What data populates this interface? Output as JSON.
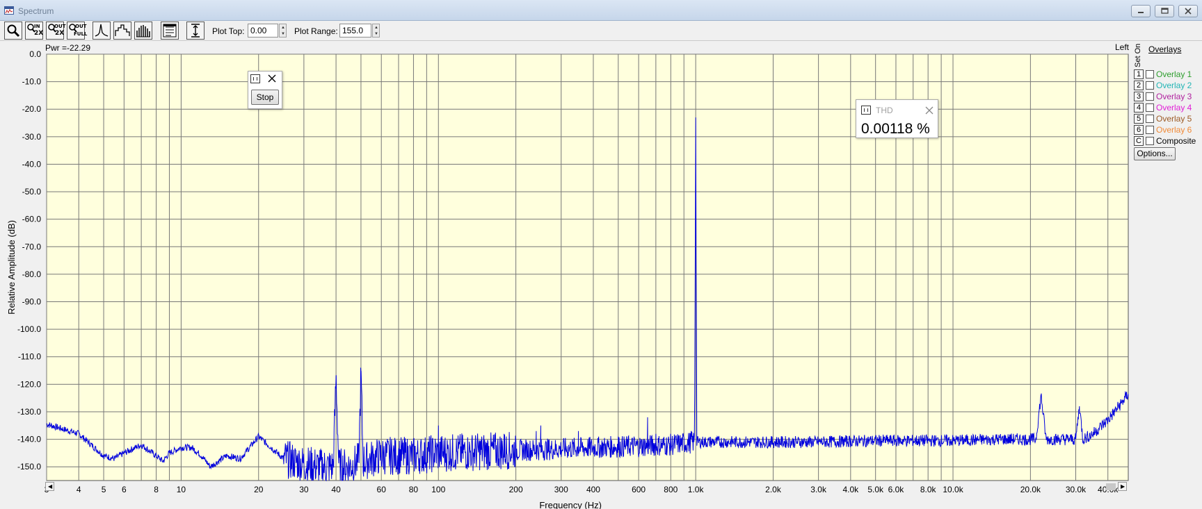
{
  "window": {
    "title": "Spectrum",
    "controls": [
      "minimize",
      "restore",
      "close"
    ]
  },
  "toolbar": {
    "buttons": [
      {
        "name": "zoom-icon"
      },
      {
        "name": "zoom-in-2x-icon",
        "line1": "IN",
        "line2": "2X"
      },
      {
        "name": "zoom-out-2x-icon",
        "line1": "OUT",
        "line2": "2X"
      },
      {
        "name": "zoom-out-full-icon",
        "line1": "OUT",
        "line2": "FULL"
      },
      {
        "name": "line-graph-icon"
      },
      {
        "name": "step-graph-icon"
      },
      {
        "name": "bar-graph-icon"
      },
      {
        "name": "settings-panel-icon"
      },
      {
        "name": "vertical-range-icon"
      }
    ],
    "plot_top_label": "Plot Top:",
    "plot_top_value": "0.00",
    "plot_range_label": "Plot Range:",
    "plot_range_value": "155.0"
  },
  "readout": {
    "power": "Pwr =-22.29",
    "channel": "Left"
  },
  "stop_window": {
    "button_label": "Stop"
  },
  "thd_window": {
    "title": "THD",
    "value": "0.00118 %"
  },
  "overlays": {
    "header": "Overlays",
    "column_labels": "Set On",
    "rows": [
      {
        "set": "1",
        "label": "Overlay 1",
        "color": "#2e9e2e",
        "checked": false
      },
      {
        "set": "2",
        "label": "Overlay 2",
        "color": "#22b5b5",
        "checked": false
      },
      {
        "set": "3",
        "label": "Overlay 3",
        "color": "#b0219e",
        "checked": false
      },
      {
        "set": "4",
        "label": "Overlay 4",
        "color": "#e01fd6",
        "checked": false
      },
      {
        "set": "5",
        "label": "Overlay 5",
        "color": "#9c5a24",
        "checked": false
      },
      {
        "set": "6",
        "label": "Overlay 6",
        "color": "#f08a38",
        "checked": false
      },
      {
        "set": "C",
        "label": "Composite",
        "color": "#000000",
        "checked": false
      }
    ],
    "options_label": "Options..."
  },
  "chart_data": {
    "type": "line",
    "title": "",
    "xlabel": "Frequency (Hz)",
    "ylabel": "Relative Amplitude (dB)",
    "x_scale": "log",
    "xlim": [
      3,
      48000
    ],
    "ylim": [
      -155,
      0
    ],
    "y_ticks": [
      "0.0",
      "-10.0",
      "-20.0",
      "-30.0",
      "-40.0",
      "-50.0",
      "-60.0",
      "-70.0",
      "-80.0",
      "-90.0",
      "-100.0",
      "-110.0",
      "-120.0",
      "-130.0",
      "-140.0",
      "-150.0"
    ],
    "x_tick_labels": [
      {
        "f": 3,
        "label": "3"
      },
      {
        "f": 4,
        "label": "4"
      },
      {
        "f": 5,
        "label": "5"
      },
      {
        "f": 6,
        "label": "6"
      },
      {
        "f": 8,
        "label": "8"
      },
      {
        "f": 10,
        "label": "10"
      },
      {
        "f": 20,
        "label": "20"
      },
      {
        "f": 30,
        "label": "30"
      },
      {
        "f": 40,
        "label": "40"
      },
      {
        "f": 60,
        "label": "60"
      },
      {
        "f": 80,
        "label": "80"
      },
      {
        "f": 100,
        "label": "100"
      },
      {
        "f": 200,
        "label": "200"
      },
      {
        "f": 300,
        "label": "300"
      },
      {
        "f": 400,
        "label": "400"
      },
      {
        "f": 600,
        "label": "600"
      },
      {
        "f": 800,
        "label": "800"
      },
      {
        "f": 1000,
        "label": "1.0k"
      },
      {
        "f": 2000,
        "label": "2.0k"
      },
      {
        "f": 3000,
        "label": "3.0k"
      },
      {
        "f": 4000,
        "label": "4.0k"
      },
      {
        "f": 5000,
        "label": "5.0k"
      },
      {
        "f": 6000,
        "label": "6.0k"
      },
      {
        "f": 8000,
        "label": "8.0k"
      },
      {
        "f": 10000,
        "label": "10.0k"
      },
      {
        "f": 20000,
        "label": "20.0k"
      },
      {
        "f": 30000,
        "label": "30.0k"
      },
      {
        "f": 40000,
        "label": "40.0k"
      }
    ],
    "grid": true,
    "background": "#ffffdd",
    "line_color": "#0000dd",
    "series": [
      {
        "name": "",
        "noise_floor_points": [
          [
            3,
            -134.5
          ],
          [
            4,
            -138
          ],
          [
            5,
            -146
          ],
          [
            5.5,
            -147
          ],
          [
            6,
            -145
          ],
          [
            7,
            -142
          ],
          [
            8,
            -146
          ],
          [
            8.5,
            -148
          ],
          [
            9,
            -145
          ],
          [
            10,
            -143
          ],
          [
            11,
            -143
          ],
          [
            12,
            -146
          ],
          [
            13,
            -150
          ],
          [
            15,
            -146
          ],
          [
            17,
            -147
          ],
          [
            20,
            -139
          ],
          [
            25,
            -147
          ],
          [
            30,
            -149
          ],
          [
            35,
            -150
          ],
          [
            39,
            -150
          ],
          [
            40,
            -117
          ],
          [
            41,
            -150
          ],
          [
            45,
            -150
          ],
          [
            49,
            -148
          ],
          [
            50,
            -115.5
          ],
          [
            51,
            -148
          ],
          [
            60,
            -146
          ],
          [
            80,
            -146
          ],
          [
            100,
            -145
          ],
          [
            200,
            -144
          ],
          [
            300,
            -143.5
          ],
          [
            400,
            -143
          ],
          [
            600,
            -142.5
          ],
          [
            800,
            -142
          ],
          [
            990,
            -141
          ],
          [
            1000,
            -23
          ],
          [
            1010,
            -141
          ],
          [
            2000,
            -141
          ],
          [
            3000,
            -141
          ],
          [
            5000,
            -140.5
          ],
          [
            10000,
            -140.5
          ],
          [
            15000,
            -140
          ],
          [
            20000,
            -140
          ],
          [
            21000,
            -140
          ],
          [
            22000,
            -124
          ],
          [
            23000,
            -140
          ],
          [
            28000,
            -140
          ],
          [
            30000,
            -140
          ],
          [
            31000,
            -128
          ],
          [
            32000,
            -140
          ],
          [
            35000,
            -138
          ],
          [
            40000,
            -133
          ],
          [
            45000,
            -127
          ],
          [
            48000,
            -123.5
          ]
        ],
        "spurs": [
          [
            100,
            -135
          ],
          [
            130,
            -140
          ],
          [
            180,
            -138
          ],
          [
            240,
            -137
          ],
          [
            250,
            -135
          ],
          [
            350,
            -137
          ],
          [
            420,
            -140
          ],
          [
            500,
            -139
          ],
          [
            650,
            -132
          ],
          [
            700,
            -138
          ],
          [
            960,
            -137
          ]
        ]
      }
    ]
  }
}
